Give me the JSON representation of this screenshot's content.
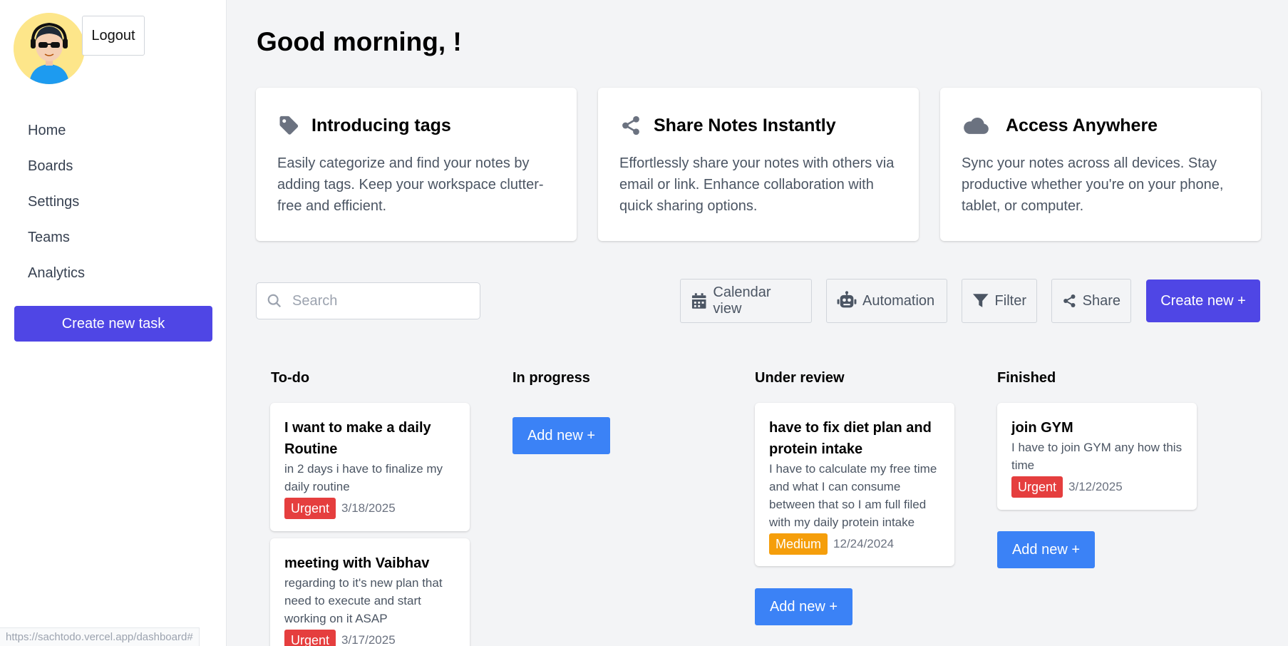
{
  "sidebar": {
    "logout_label": "Logout",
    "nav": [
      "Home",
      "Boards",
      "Settings",
      "Teams",
      "Analytics"
    ],
    "create_task_label": "Create new task"
  },
  "status_bar_url": "https://sachtodo.vercel.app/dashboard#",
  "greeting": "Good morning, !",
  "features": [
    {
      "icon": "tag-icon",
      "title": "Introducing tags",
      "description": "Easily categorize and find your notes by adding tags. Keep your workspace clutter-free and efficient."
    },
    {
      "icon": "share-icon",
      "title": "Share Notes Instantly",
      "description": "Effortlessly share your notes with others via email or link. Enhance collaboration with quick sharing options."
    },
    {
      "icon": "cloud-icon",
      "title": "Access Anywhere",
      "description": "Sync your notes across all devices. Stay productive whether you're on your phone, tablet, or computer."
    }
  ],
  "toolbar": {
    "search_placeholder": "Search",
    "calendar_label": "Calendar view",
    "automation_label": "Automation",
    "filter_label": "Filter",
    "share_label": "Share",
    "create_new_label": "Create new +"
  },
  "board": {
    "add_new_label": "Add new +",
    "columns": [
      {
        "title": "To-do",
        "tasks": [
          {
            "title": "I want to make a daily Routine",
            "description": "in 2 days i have to finalize my daily routine",
            "priority": "Urgent",
            "date": "3/18/2025"
          },
          {
            "title": "meeting with Vaibhav",
            "description": "regarding to it's new plan that need to execute and start working on it ASAP",
            "priority": "Urgent",
            "date": "3/17/2025"
          }
        ]
      },
      {
        "title": "In progress",
        "tasks": []
      },
      {
        "title": "Under review",
        "tasks": [
          {
            "title": "have to fix diet plan and protein intake",
            "description": "I have to calculate my free time and what I can consume between that so I am full filed with my daily protein intake",
            "priority": "Medium",
            "date": "12/24/2024"
          }
        ]
      },
      {
        "title": "Finished",
        "tasks": [
          {
            "title": "join GYM",
            "description": "I have to join GYM any how this time",
            "priority": "Urgent",
            "date": "3/12/2025"
          }
        ]
      }
    ]
  },
  "colors": {
    "primary": "#4f46e5",
    "add_button": "#3b82f6",
    "urgent": "#e53e3e",
    "medium": "#f59e0b"
  }
}
